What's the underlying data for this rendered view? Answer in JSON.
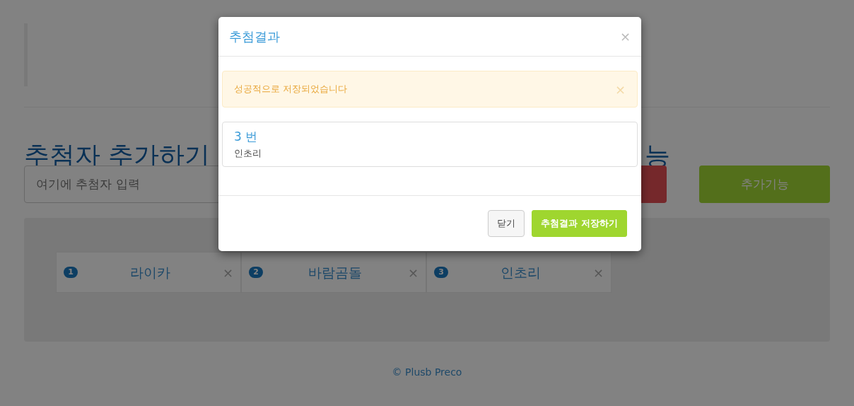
{
  "page": {
    "headings": [
      "추첨자 추가하기",
      "능"
    ],
    "input": {
      "placeholder": "여기에 추첨자 입력"
    },
    "extra_button": {
      "label": "추가기능"
    },
    "entries": [
      {
        "number": "1",
        "name": "라이카",
        "remove": "×"
      },
      {
        "number": "2",
        "name": "바람곰돌",
        "remove": "×"
      },
      {
        "number": "3",
        "name": "인초리",
        "remove": "×"
      }
    ],
    "footer": "© Plusb Preco"
  },
  "modal": {
    "title": "추첨결과",
    "close": "×",
    "alert": {
      "text": "성공적으로 저장되었습니다",
      "close": "×"
    },
    "result": {
      "number": "3 번",
      "name": "인초리"
    },
    "buttons": [
      {
        "label": "닫기",
        "kind": "default"
      },
      {
        "label": "추첨결과 저장하기",
        "kind": "success"
      }
    ]
  }
}
